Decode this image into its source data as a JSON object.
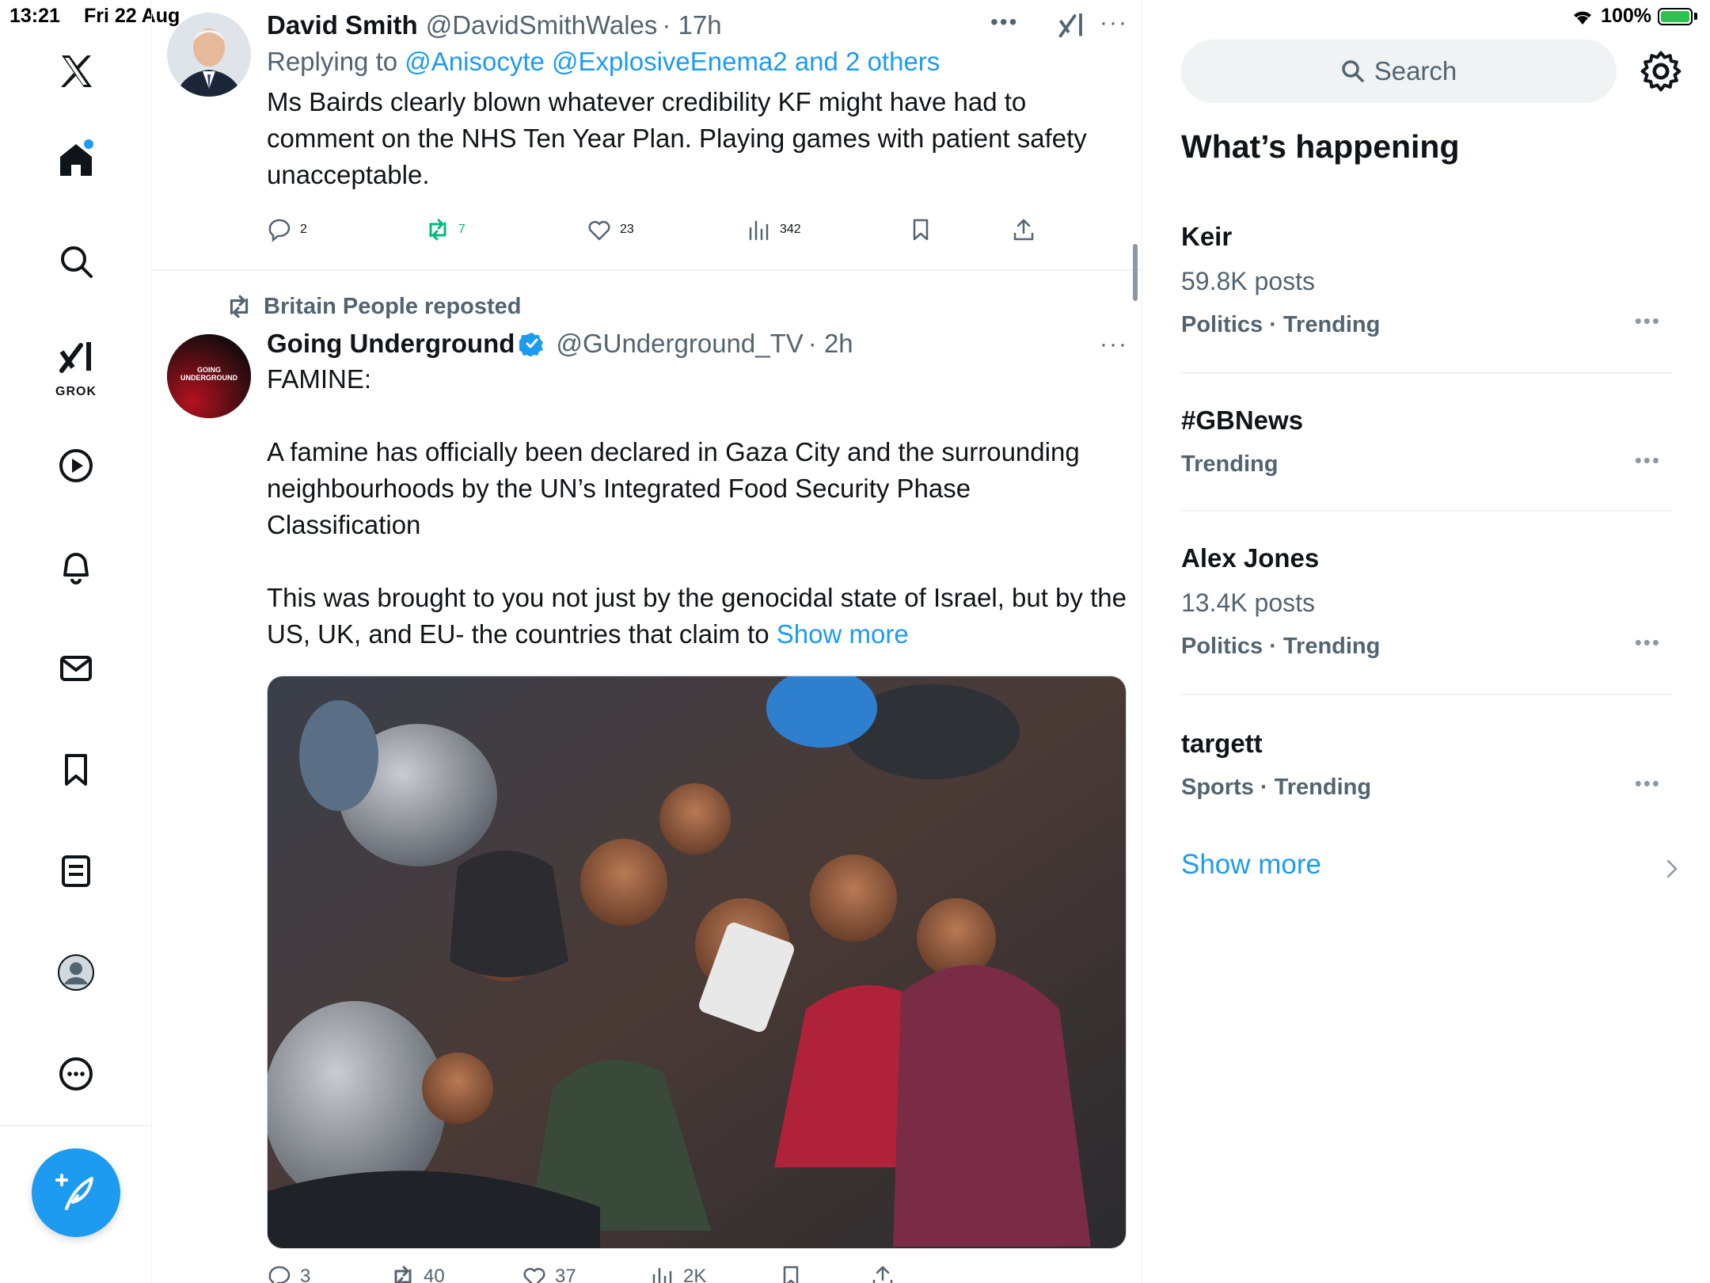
{
  "status_bar": {
    "time": "13:21",
    "date": "Fri 22 Aug",
    "battery": "100%"
  },
  "nav": {
    "items": [
      "x-logo",
      "home",
      "explore",
      "grok",
      "video",
      "notifications",
      "messages",
      "bookmarks",
      "lists",
      "profile",
      "more"
    ],
    "grok_label": "GROK"
  },
  "tweet1": {
    "name": "David Smith",
    "handle": "@DavidSmithWales",
    "time": "· 17h",
    "reply_prefix": "Replying to",
    "reply_to": "@Anisocyte @ExplosiveEnema2 and 2 others",
    "text": "Ms Bairds clearly blown whatever credibility KF might have had to comment on the NHS Ten Year Plan. Playing games with patient safety unacceptable.",
    "replies": "2",
    "reposts": "7",
    "likes": "23",
    "views": "342"
  },
  "tweet2": {
    "repost_by": "Britain People reposted",
    "name": "Going Underground",
    "handle": "@GUnderground_TV",
    "time": "· 2h",
    "avatar_text_line1": "GOING",
    "avatar_text_line2": "UNDERGROUND",
    "text_title": "FAMINE:",
    "text_p1": "A famine has officially been declared in Gaza City and the surrounding neighbourhoods by the UN’s Integrated Food Security Phase Classification",
    "text_p2": "This was brought to you not just by the genocidal state of Israel, but by the US, UK, and EU- the countries that claim to ",
    "show_more": "Show more",
    "replies": "3",
    "reposts": "40",
    "likes": "37",
    "views": "2K"
  },
  "sidebar": {
    "search_placeholder": "Search",
    "title": "What’s happening",
    "trends": [
      {
        "name": "Keir",
        "posts": "59.8K posts",
        "category": "Politics · Trending"
      },
      {
        "name": "#GBNews",
        "posts": "",
        "category": "Trending"
      },
      {
        "name": "Alex Jones",
        "posts": "13.4K posts",
        "category": "Politics · Trending"
      },
      {
        "name": "targett",
        "posts": "",
        "category": "Sports · Trending"
      }
    ],
    "show_more": "Show more"
  },
  "colors": {
    "accent": "#1d9bf0",
    "repost_green": "#00ba7c",
    "muted": "#536471"
  }
}
